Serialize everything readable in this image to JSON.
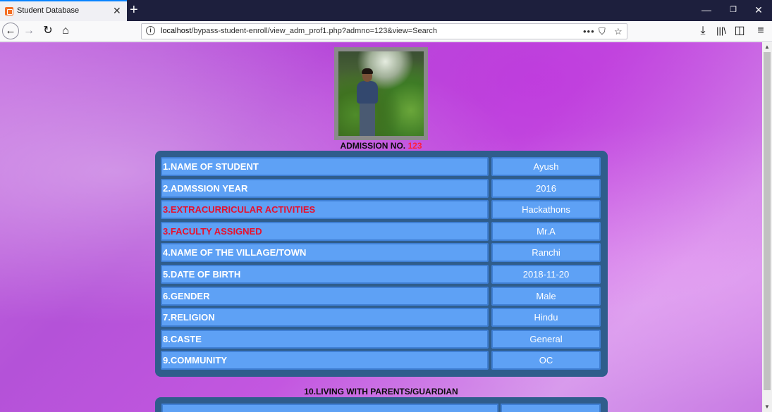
{
  "browser": {
    "tab_title": "Student Database",
    "url_host": "localhost",
    "url_path": "/bypass-student-enroll/view_adm_prof1.php?admno=123&view=Search"
  },
  "page": {
    "admission_label": "ADMISSION NO.",
    "admission_number": "123",
    "rows": [
      {
        "label": "1.NAME OF STUDENT",
        "value": "Ayush",
        "label_color": "#ffffff"
      },
      {
        "label": "2.ADMSSION YEAR",
        "value": "2016",
        "label_color": "#ffffff"
      },
      {
        "label": "3.EXTRACURRICULAR ACTIVITIES",
        "value": "Hackathons",
        "label_color": "#e8102d"
      },
      {
        "label": "3.FACULTY ASSIGNED",
        "value": "Mr.A",
        "label_color": "#e8102d"
      },
      {
        "label": "4.NAME OF THE VILLAGE/TOWN",
        "value": "Ranchi",
        "label_color": "#ffffff"
      },
      {
        "label": "5.DATE OF BIRTH",
        "value": "2018-11-20",
        "label_color": "#ffffff"
      },
      {
        "label": "6.GENDER",
        "value": "Male",
        "label_color": "#ffffff"
      },
      {
        "label": "7.RELIGION",
        "value": "Hindu",
        "label_color": "#ffffff"
      },
      {
        "label": "8.CASTE",
        "value": "General",
        "label_color": "#ffffff"
      },
      {
        "label": "9.COMMUNITY",
        "value": "OC",
        "label_color": "#ffffff"
      }
    ],
    "section2_title": "10.LIVING WITH PARENTS/GUARDIAN"
  },
  "icons": {
    "back": "back-arrow-icon",
    "forward": "forward-arrow-icon",
    "reload": "reload-icon",
    "home": "home-icon",
    "info": "info-icon",
    "more": "more-icon",
    "pocket": "pocket-icon",
    "bookmark": "star-icon",
    "download": "download-icon",
    "library": "library-icon",
    "sidebar": "sidebar-icon",
    "menu": "hamburger-menu-icon"
  },
  "colors": {
    "table_bg": "#2f5d8c",
    "cell_bg": "#5ea1f5",
    "admission_number": "#ff1f3c"
  }
}
